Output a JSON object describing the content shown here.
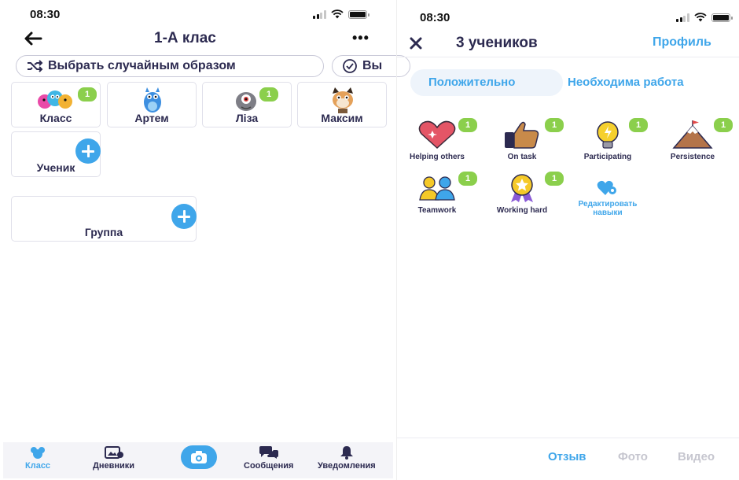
{
  "left": {
    "status": {
      "time": "08:30"
    },
    "header": {
      "title": "1-А клас",
      "more": "•••"
    },
    "actions": {
      "random": "Выбрать случайным образом",
      "second": "Вы"
    },
    "tiles": [
      {
        "name": "Класс",
        "badge": "1"
      },
      {
        "name": "Артем",
        "badge": ""
      },
      {
        "name": "Ліза",
        "badge": "1"
      },
      {
        "name": "Максим",
        "badge": ""
      }
    ],
    "add_student": "Ученик",
    "add_group": "Группа",
    "tabs": [
      {
        "label": "Класс"
      },
      {
        "label": "Дневники"
      },
      {
        "label": ""
      },
      {
        "label": "Сообщения"
      },
      {
        "label": "Уведомления"
      }
    ]
  },
  "right": {
    "status": {
      "time": "08:30"
    },
    "header": {
      "title": "3 учеников",
      "profile": "Профиль"
    },
    "segments": {
      "positive": "Положительно",
      "needs_work": "Необходима работа"
    },
    "skills": [
      {
        "label": "Helping others",
        "badge": "1"
      },
      {
        "label": "On task",
        "badge": "1"
      },
      {
        "label": "Participating",
        "badge": "1"
      },
      {
        "label": "Persistence",
        "badge": "1"
      },
      {
        "label": "Teamwork",
        "badge": "1"
      },
      {
        "label": "Working hard",
        "badge": "1"
      }
    ],
    "edit_skills": "Редактировать навыки",
    "footer": {
      "feedback": "Отзыв",
      "photo": "Фото",
      "video": "Видео"
    }
  },
  "colors": {
    "accent": "#3fa6ea",
    "badge": "#8bcf4c",
    "text": "#2c2a50"
  }
}
